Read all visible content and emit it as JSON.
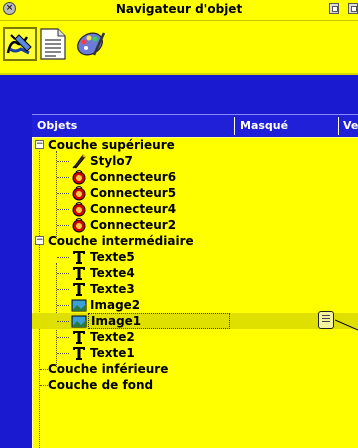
{
  "window": {
    "title": "Navigateur d'objet"
  },
  "header": {
    "col_objects": "Objets",
    "col_hidden": "Masqué",
    "col_locked": "Ver"
  },
  "tree": {
    "layers": [
      {
        "label": "Couche supérieure",
        "items": [
          {
            "label": "Stylo7",
            "icon": "pen-icon"
          },
          {
            "label": "Connecteur6",
            "icon": "connector-icon"
          },
          {
            "label": "Connecteur5",
            "icon": "connector-icon"
          },
          {
            "label": "Connecteur4",
            "icon": "connector-icon"
          },
          {
            "label": "Connecteur2",
            "icon": "connector-icon"
          }
        ]
      },
      {
        "label": "Couche intermédiaire",
        "items": [
          {
            "label": "Texte5",
            "icon": "text-icon"
          },
          {
            "label": "Texte4",
            "icon": "text-icon"
          },
          {
            "label": "Texte3",
            "icon": "text-icon"
          },
          {
            "label": "Image2",
            "icon": "image-icon"
          },
          {
            "label": "Image1",
            "icon": "image-icon",
            "selected": true
          },
          {
            "label": "Texte2",
            "icon": "text-icon"
          },
          {
            "label": "Texte1",
            "icon": "text-icon"
          }
        ]
      },
      {
        "label": "Couche inférieure",
        "items": []
      },
      {
        "label": "Couche de fond",
        "items": []
      }
    ]
  },
  "colors": {
    "chrome": "#ffff00",
    "background": "#1a1ad0",
    "selection": "#e0e000"
  }
}
